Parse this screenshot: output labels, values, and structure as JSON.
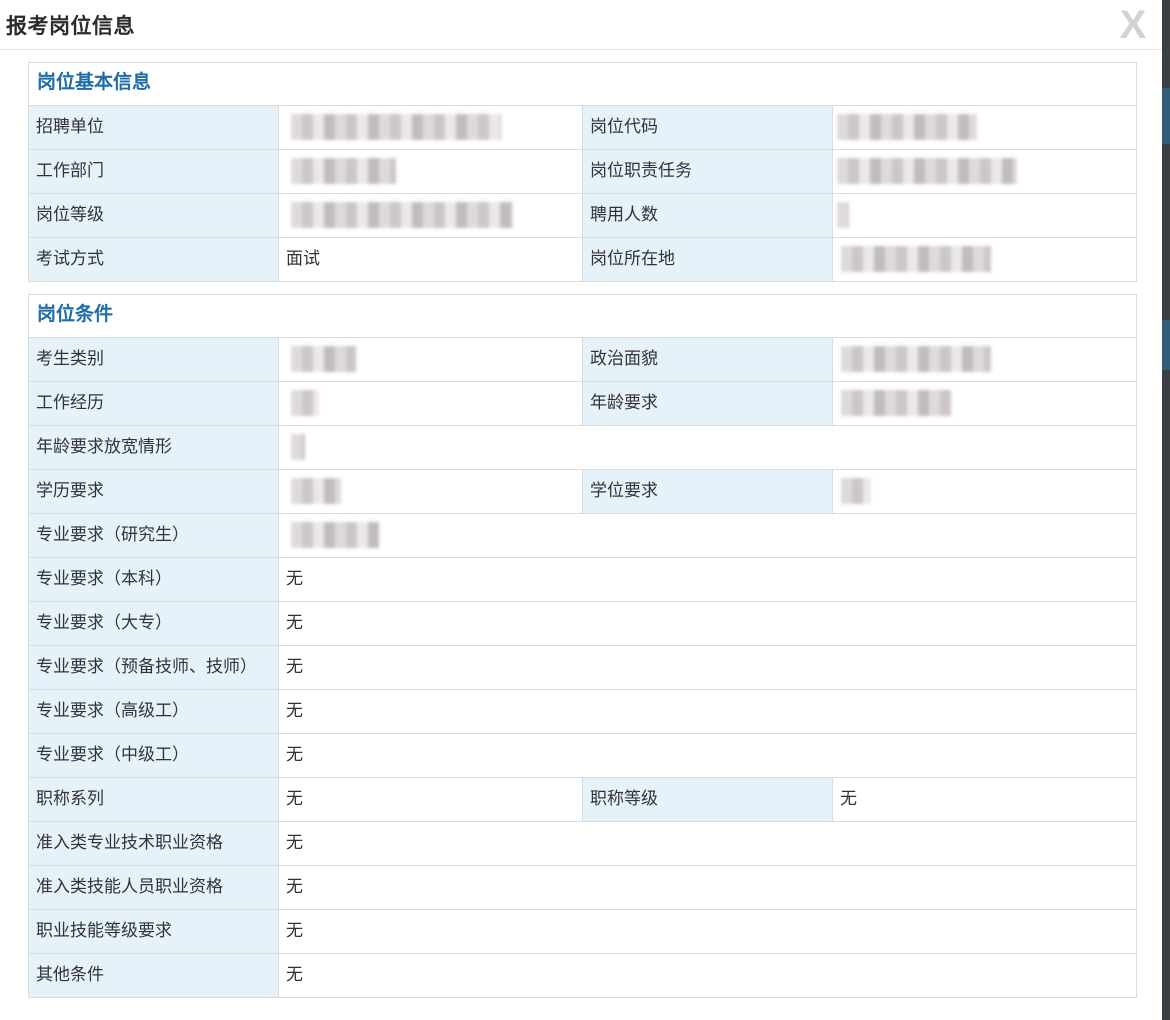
{
  "modal": {
    "title": "报考岗位信息",
    "close_label": "X"
  },
  "basic": {
    "title": "岗位基本信息",
    "rows": [
      {
        "label1": "招聘单位",
        "value1": "",
        "label2": "岗位代码",
        "value2": ""
      },
      {
        "label1": "工作部门",
        "value1": "",
        "label2": "岗位职责任务",
        "value2": ""
      },
      {
        "label1": "岗位等级",
        "value1": "",
        "label2": "聘用人数",
        "value2": ""
      },
      {
        "label1": "考试方式",
        "value1": "面试",
        "label2": "岗位所在地",
        "value2": ""
      }
    ]
  },
  "conditions": {
    "title": "岗位条件",
    "pair_rows": [
      {
        "label1": "考生类别",
        "value1": "",
        "label2": "政治面貌",
        "value2": ""
      },
      {
        "label1": "工作经历",
        "value1": "",
        "label2": "年龄要求",
        "value2": ""
      }
    ],
    "age_relax": {
      "label": "年龄要求放宽情形",
      "value": ""
    },
    "degree_row": {
      "label1": "学历要求",
      "value1": "",
      "label2": "学位要求",
      "value2": ""
    },
    "major_rows": [
      {
        "label": "专业要求（研究生）",
        "value": ""
      },
      {
        "label": "专业要求（本科）",
        "value": "无"
      },
      {
        "label": "专业要求（大专）",
        "value": "无"
      },
      {
        "label": "专业要求（预备技师、技师）",
        "value": "无"
      },
      {
        "label": "专业要求（高级工）",
        "value": "无"
      },
      {
        "label": "专业要求（中级工）",
        "value": "无"
      }
    ],
    "title_row": {
      "label1": "职称系列",
      "value1": "无",
      "label2": "职称等级",
      "value2": "无"
    },
    "bottom_rows": [
      {
        "label": "准入类专业技术职业资格",
        "value": "无"
      },
      {
        "label": "准入类技能人员职业资格",
        "value": "无"
      },
      {
        "label": "职业技能等级要求",
        "value": "无"
      },
      {
        "label": "其他条件",
        "value": "无"
      }
    ]
  },
  "colors": {
    "section_title": "#1e6ca8",
    "label_bg": "#e6f2f9",
    "border": "#dcdcdc"
  }
}
